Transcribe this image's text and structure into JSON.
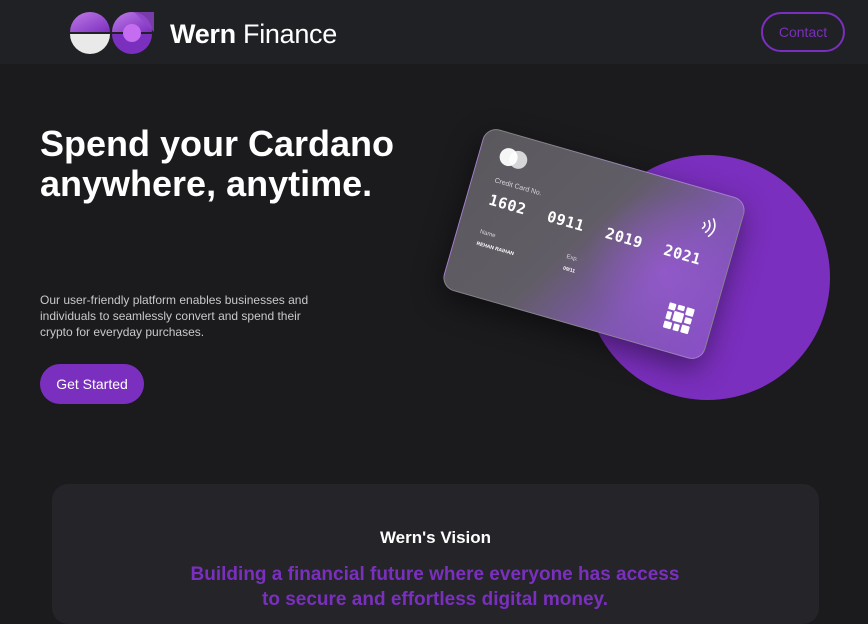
{
  "header": {
    "brand_name": "Wern",
    "brand_suffix": "Finance",
    "contact_label": "Contact"
  },
  "hero": {
    "title": "Spend your Cardano anywhere, anytime.",
    "description": "Our user-friendly platform enables businesses and individuals to seamlessly convert and spend their crypto for everyday purchases.",
    "cta_label": "Get Started"
  },
  "card": {
    "number_label": "Credit Card No.",
    "number_groups": [
      "1602",
      "0911",
      "2019",
      "2021"
    ],
    "name_label": "Name",
    "name_value": "REHAN RAIHAN",
    "exp_label": "Exp.",
    "exp_value": "09/11"
  },
  "vision": {
    "title": "Wern's Vision",
    "text": "Building a financial future where everyone has access to secure and effortless digital money."
  },
  "colors": {
    "accent": "#7b2fbe",
    "background": "#1b1a1d",
    "header_bg": "#202124",
    "panel_bg": "#242429"
  },
  "icons": {
    "logo": "wern-logo-icon",
    "card_logo": "card-brand-icon",
    "contactless": "contactless-icon",
    "chip": "card-chip-icon"
  }
}
